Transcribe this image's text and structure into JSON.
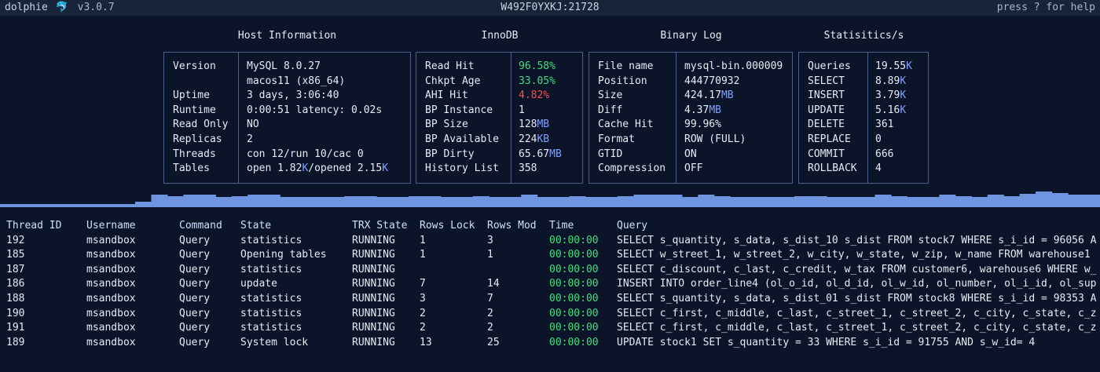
{
  "topbar": {
    "app_name": "dolphie",
    "logo_glyph": "🐬",
    "version": "v3.0.7",
    "host": "W492F0YXKJ:21728",
    "help": "press ? for help"
  },
  "panels": {
    "host": {
      "title": "Host Information",
      "rows": [
        {
          "k": "Version",
          "v": "MySQL 8.0.27"
        },
        {
          "k": "",
          "v": "macos11 (x86_64)"
        },
        {
          "k": "Uptime",
          "v": "3 days, 3:06:40"
        },
        {
          "k": "Runtime",
          "v": "0:00:51 latency: 0.02s"
        },
        {
          "k": "Read Only",
          "v": "NO"
        },
        {
          "k": "Replicas",
          "v": "2"
        },
        {
          "k": "Threads",
          "v": "con 12/run 10/cac 0"
        },
        {
          "k": "Tables",
          "v_a": "open 1.82",
          "v_a_unit": "K",
          "v_b": "/opened 2.15",
          "v_b_unit": "K"
        }
      ]
    },
    "innodb": {
      "title": "InnoDB",
      "rows": [
        {
          "k": "Read Hit",
          "v": "96.58%",
          "color": "#3ce07a"
        },
        {
          "k": "Chkpt Age",
          "v": "33.05%",
          "color": "#3ce07a"
        },
        {
          "k": "AHI Hit",
          "v": "4.82%",
          "color": "#ff4d4d"
        },
        {
          "k": "BP Instance",
          "v": "1"
        },
        {
          "k": "BP Size",
          "v": "128",
          "unit": "MB"
        },
        {
          "k": "BP Available",
          "v": "224",
          "unit": "KB"
        },
        {
          "k": "BP Dirty",
          "v": "65.67",
          "unit": "MB"
        },
        {
          "k": "History List",
          "v": "358"
        }
      ]
    },
    "binlog": {
      "title": "Binary Log",
      "rows": [
        {
          "k": "File name",
          "v": "mysql-bin.000009"
        },
        {
          "k": "Position",
          "v": "444770932"
        },
        {
          "k": "Size",
          "v": "424.17",
          "unit": "MB"
        },
        {
          "k": "Diff",
          "v": "4.37",
          "unit": "MB"
        },
        {
          "k": "Cache Hit",
          "v": "99.96%"
        },
        {
          "k": "Format",
          "v": "ROW (FULL)"
        },
        {
          "k": "GTID",
          "v": "ON"
        },
        {
          "k": "Compression",
          "v": "OFF"
        }
      ]
    },
    "stats": {
      "title": "Statisitics/s",
      "rows": [
        {
          "k": "Queries",
          "v": "19.55",
          "unit": "K"
        },
        {
          "k": "SELECT",
          "v": "8.89",
          "unit": "K"
        },
        {
          "k": "INSERT",
          "v": "3.79",
          "unit": "K"
        },
        {
          "k": "UPDATE",
          "v": "5.16",
          "unit": "K"
        },
        {
          "k": "DELETE",
          "v": "361"
        },
        {
          "k": "REPLACE",
          "v": "0"
        },
        {
          "k": "COMMIT",
          "v": "666"
        },
        {
          "k": "ROLLBACK",
          "v": "4"
        }
      ]
    }
  },
  "graph": {
    "color": "#6f95e0",
    "levels": [
      0.25,
      0.62,
      0.55,
      0.62,
      0.62,
      0.5,
      0.55,
      0.6,
      0.6,
      0.5,
      0.5,
      0.5,
      0.5,
      0.52,
      0.52,
      0.5,
      0.5,
      0.55,
      0.55,
      0.5,
      0.5,
      0.55,
      0.5,
      0.5,
      0.6,
      0.5,
      0.5,
      0.55,
      0.5,
      0.5,
      0.55,
      0.6,
      0.62,
      0.6,
      0.5,
      0.62,
      0.55,
      0.5,
      0.5,
      0.5,
      0.5,
      0.55,
      0.55,
      0.5,
      0.5,
      0.5,
      0.6,
      0.55,
      0.5,
      0.5,
      0.62,
      0.55,
      0.5,
      0.6,
      0.55,
      0.65,
      0.75,
      0.7,
      0.6,
      0.6
    ]
  },
  "processlist": {
    "headers": {
      "id": "Thread ID",
      "user": "Username",
      "cmd": "Command",
      "state": "State",
      "trx": "TRX State",
      "lock": "Rows Lock",
      "mod": "Rows Mod",
      "time": "Time",
      "query": "Query"
    },
    "rows": [
      {
        "id": "192",
        "user": "msandbox",
        "cmd": "Query",
        "state": "statistics",
        "trx": "RUNNING",
        "lock": "1",
        "mod": "3",
        "time": "00:00:00",
        "query": "SELECT s_quantity, s_data, s_dist_10 s_dist FROM stock7 WHERE s_i_id = 96056 A"
      },
      {
        "id": "185",
        "user": "msandbox",
        "cmd": "Query",
        "state": "Opening tables",
        "trx": "RUNNING",
        "lock": "1",
        "mod": "1",
        "time": "00:00:00",
        "query": "SELECT w_street_1, w_street_2, w_city, w_state, w_zip, w_name FROM warehouse1"
      },
      {
        "id": "187",
        "user": "msandbox",
        "cmd": "Query",
        "state": "statistics",
        "trx": "RUNNING",
        "lock": "",
        "mod": "",
        "time": "00:00:00",
        "query": "SELECT c_discount, c_last, c_credit, w_tax FROM customer6, warehouse6 WHERE w_"
      },
      {
        "id": "186",
        "user": "msandbox",
        "cmd": "Query",
        "state": "update",
        "trx": "RUNNING",
        "lock": "7",
        "mod": "14",
        "time": "00:00:00",
        "query": "INSERT INTO order_line4 (ol_o_id, ol_d_id, ol_w_id, ol_number, ol_i_id, ol_sup"
      },
      {
        "id": "188",
        "user": "msandbox",
        "cmd": "Query",
        "state": "statistics",
        "trx": "RUNNING",
        "lock": "3",
        "mod": "7",
        "time": "00:00:00",
        "query": "SELECT s_quantity, s_data, s_dist_01 s_dist FROM stock8 WHERE s_i_id = 98353 A"
      },
      {
        "id": "190",
        "user": "msandbox",
        "cmd": "Query",
        "state": "statistics",
        "trx": "RUNNING",
        "lock": "2",
        "mod": "2",
        "time": "00:00:00",
        "query": "SELECT c_first, c_middle, c_last, c_street_1, c_street_2, c_city, c_state, c_z"
      },
      {
        "id": "191",
        "user": "msandbox",
        "cmd": "Query",
        "state": "statistics",
        "trx": "RUNNING",
        "lock": "2",
        "mod": "2",
        "time": "00:00:00",
        "query": "SELECT c_first, c_middle, c_last, c_street_1, c_street_2, c_city, c_state, c_z"
      },
      {
        "id": "189",
        "user": "msandbox",
        "cmd": "Query",
        "state": "System lock",
        "trx": "RUNNING",
        "lock": "13",
        "mod": "25",
        "time": "00:00:00",
        "query": "UPDATE stock1 SET s_quantity = 33 WHERE s_i_id = 91755 AND s_w_id= 4"
      }
    ]
  }
}
